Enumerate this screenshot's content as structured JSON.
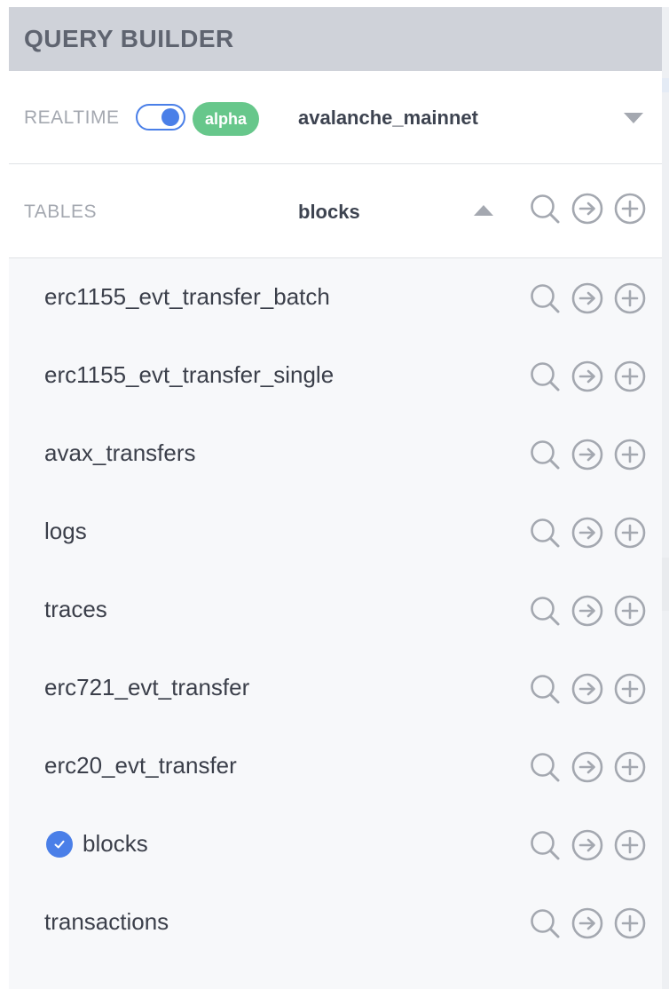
{
  "panel": {
    "title": "QUERY BUILDER"
  },
  "realtime": {
    "label": "REALTIME",
    "toggle_on": true,
    "badge": "alpha",
    "network": "avalanche_mainnet"
  },
  "tables": {
    "label": "TABLES",
    "selected": "blocks",
    "items": [
      {
        "name": "erc1155_evt_transfer_batch",
        "selected": false
      },
      {
        "name": "erc1155_evt_transfer_single",
        "selected": false
      },
      {
        "name": "avax_transfers",
        "selected": false
      },
      {
        "name": "logs",
        "selected": false
      },
      {
        "name": "traces",
        "selected": false
      },
      {
        "name": "erc721_evt_transfer",
        "selected": false
      },
      {
        "name": "erc20_evt_transfer",
        "selected": false
      },
      {
        "name": "blocks",
        "selected": true
      },
      {
        "name": "transactions",
        "selected": false
      }
    ]
  },
  "icons": {
    "search": "search-icon",
    "arrow": "arrow-right-circle-icon",
    "add": "plus-circle-icon",
    "check": "check-circle-icon"
  },
  "colors": {
    "header_bg": "#cfd2d9",
    "accent": "#4a7fe8",
    "badge": "#67c78b",
    "muted_icon": "#a4a8b0"
  }
}
